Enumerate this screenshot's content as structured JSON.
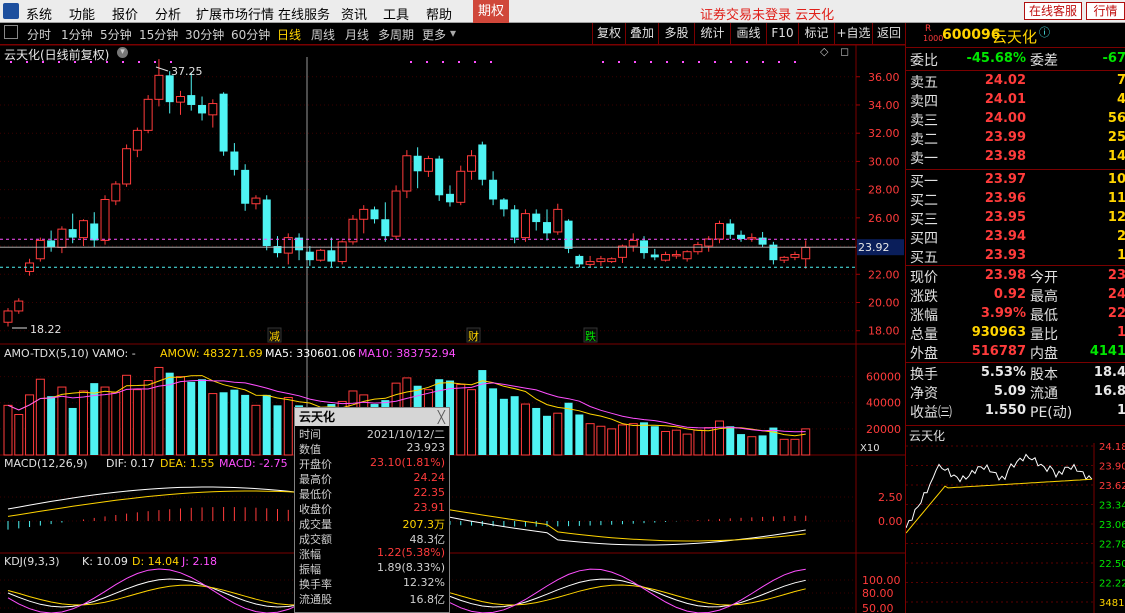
{
  "menu": {
    "items": [
      "系统",
      "功能",
      "报价",
      "分析",
      "扩展市场行情",
      "在线服务",
      "资讯",
      "工具",
      "帮助"
    ],
    "qiquan": "期权",
    "notice": "证券交易未登录  云天化",
    "online_service": "在线客服",
    "quote_btn": "行情"
  },
  "toolbar": {
    "periods": [
      "分时",
      "1分钟",
      "5分钟",
      "15分钟",
      "30分钟",
      "60分钟",
      "日线",
      "周线",
      "月线",
      "多周期",
      "更多"
    ],
    "active_period": "日线",
    "buttons": [
      "复权",
      "叠加",
      "多股",
      "统计",
      "画线",
      "F10",
      "标记",
      "+自选",
      "返回"
    ]
  },
  "chart": {
    "title": "云天化(日线前复权)",
    "high_label": "37.25",
    "low_label": "18.22",
    "price_ticks": [
      "36.00",
      "34.00",
      "32.00",
      "30.00",
      "28.00",
      "26.00",
      "24.00",
      "22.00",
      "20.00",
      "18.00"
    ],
    "current_price": "23.92",
    "markers": [
      "减",
      "财",
      "跌"
    ],
    "vol_title": "AMO-TDX(5,10)  VAMO: -",
    "vol_amow": "AMOW: 483271.69",
    "vol_ma5": "MA5: 330601.06",
    "vol_ma10": "MA10: 383752.94",
    "vol_ticks": [
      "60000",
      "40000",
      "20000"
    ],
    "vol_unit": "X10",
    "macd_title": "MACD(12,26,9)",
    "macd_dif": "DIF: 0.17",
    "macd_dea": "DEA: 1.55",
    "macd_val": "MACD: -2.75",
    "macd_ticks": [
      "2.50",
      "0.00"
    ],
    "kdj_title": "KDJ(9,3,3)",
    "kdj_k": "K: 10.09",
    "kdj_d": "D: 14.04",
    "kdj_j": "J: 2.18",
    "kdj_ticks": [
      "100.00",
      "80.00",
      "50.00"
    ]
  },
  "popup": {
    "title": "云天化",
    "close": "╳",
    "rows": [
      {
        "k": "时间",
        "v": "2021/10/12/二",
        "c": "#d0d0d0"
      },
      {
        "k": "数值",
        "v": "23.923",
        "c": "#d0d0d0"
      },
      {
        "k": "开盘价",
        "v": "23.10(1.81%)",
        "c": "#ff3b3b"
      },
      {
        "k": "最高价",
        "v": "24.24",
        "c": "#ff3b3b"
      },
      {
        "k": "最低价",
        "v": "22.35",
        "c": "#ff3b3b"
      },
      {
        "k": "收盘价",
        "v": "23.91",
        "c": "#ff3b3b"
      },
      {
        "k": "成交量",
        "v": "207.3万",
        "c": "#ffd400"
      },
      {
        "k": "成交额",
        "v": "48.3亿",
        "c": "#d0d0d0"
      },
      {
        "k": "涨幅",
        "v": "1.22(5.38%)",
        "c": "#ff3b3b"
      },
      {
        "k": "振幅",
        "v": "1.89(8.33%)",
        "c": "#d0d0d0"
      },
      {
        "k": "换手率",
        "v": "12.32%",
        "c": "#d0d0d0"
      },
      {
        "k": "流通股",
        "v": "16.8亿",
        "c": "#d0d0d0"
      }
    ]
  },
  "quote": {
    "badge_r": "R",
    "badge_n": "1000",
    "code": "600096",
    "name": "云天化",
    "weibi_label": "委比",
    "weibi": "-45.68%",
    "weicha_label": "委差",
    "weicha": "-67",
    "sells": [
      {
        "label": "卖五",
        "price": "24.02",
        "vol": "7"
      },
      {
        "label": "卖四",
        "price": "24.01",
        "vol": "4"
      },
      {
        "label": "卖三",
        "price": "24.00",
        "vol": "56"
      },
      {
        "label": "卖二",
        "price": "23.99",
        "vol": "25"
      },
      {
        "label": "卖一",
        "price": "23.98",
        "vol": "14"
      }
    ],
    "buys": [
      {
        "label": "买一",
        "price": "23.97",
        "vol": "10"
      },
      {
        "label": "买二",
        "price": "23.96",
        "vol": "11"
      },
      {
        "label": "买三",
        "price": "23.95",
        "vol": "12"
      },
      {
        "label": "买四",
        "price": "23.94",
        "vol": "2"
      },
      {
        "label": "买五",
        "price": "23.93",
        "vol": "1"
      }
    ],
    "stats": [
      {
        "l1": "现价",
        "v1": "23.98",
        "c1": "red",
        "l2": "今开",
        "v2": "23"
      },
      {
        "l1": "涨跌",
        "v1": "0.92",
        "c1": "red",
        "l2": "最高",
        "v2": "24"
      },
      {
        "l1": "涨幅",
        "v1": "3.99%",
        "c1": "red",
        "l2": "最低",
        "v2": "22"
      },
      {
        "l1": "总量",
        "v1": "930963",
        "c1": "yel",
        "l2": "量比",
        "v2": "1"
      },
      {
        "l1": "外盘",
        "v1": "516787",
        "c1": "red",
        "l2": "内盘",
        "v2": "4141"
      }
    ],
    "stats2": [
      {
        "l1": "换手",
        "v1": "5.53%",
        "l2": "股本",
        "v2": "18.4"
      },
      {
        "l1": "净资",
        "v1": "5.09",
        "l2": "流通",
        "v2": "16.8"
      },
      {
        "l1": "收益㈢",
        "v1": "1.550",
        "l2": "PE(动)",
        "v2": "1"
      }
    ],
    "mini_title": "云天化",
    "mini_ticks": [
      "24.18",
      "23.90",
      "23.62",
      "23.34",
      "23.06",
      "22.78",
      "22.50",
      "22.22",
      "3481"
    ]
  },
  "colors": {
    "up": "#ff3b3b",
    "down": "#4ff3f3",
    "accent": "#ffd400"
  }
}
